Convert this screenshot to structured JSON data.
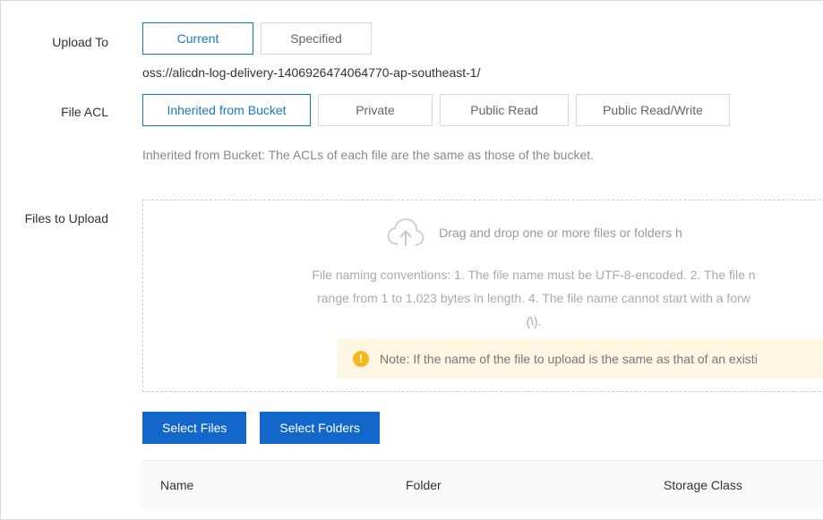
{
  "form": {
    "upload_to": {
      "label": "Upload To",
      "options": [
        "Current",
        "Specified"
      ],
      "selected": "Current",
      "path": "oss://alicdn-log-delivery-1406926474064770-ap-southeast-1/"
    },
    "file_acl": {
      "label": "File ACL",
      "options": [
        "Inherited from Bucket",
        "Private",
        "Public Read",
        "Public Read/Write"
      ],
      "selected": "Inherited from Bucket",
      "hint": "Inherited from Bucket: The ACLs of each file are the same as those of the bucket."
    },
    "files_to_upload": {
      "label": "Files to Upload",
      "dropzone": {
        "icon": "cloud-upload-icon",
        "headline": "Drag and drop one or more files or folders h",
        "naming_rules_line1": "File naming conventions: 1. The file name must be UTF-8-encoded. 2. The file n",
        "naming_rules_line2": "range from 1 to 1,023 bytes in length. 4. The file name cannot start with a forw",
        "naming_rules_line3": "(\\).",
        "note_icon": "!",
        "note_text": "Note: If the name of the file to upload is the same as that of an existi"
      },
      "buttons": {
        "select_files": "Select Files",
        "select_folders": "Select Folders"
      },
      "table": {
        "columns": [
          "Name",
          "Folder",
          "Storage Class"
        ],
        "rows": []
      }
    }
  },
  "colors": {
    "accent": "#1366ca",
    "active_border": "#0a7aca",
    "active_text": "#1878c8",
    "note_bg": "#fdf6e3",
    "note_icon": "#f9b51c",
    "border": "#d9d9d9"
  }
}
